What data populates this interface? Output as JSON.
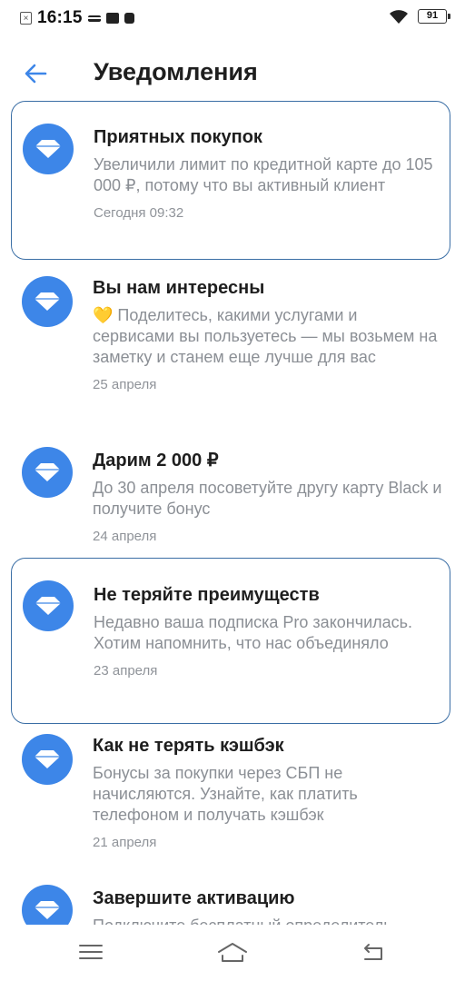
{
  "status_bar": {
    "time": "16:15",
    "battery": "91",
    "icons": [
      "close-notif-icon",
      "menu-icon",
      "message-icon",
      "mic-icon",
      "wifi-icon",
      "battery-icon"
    ]
  },
  "header": {
    "back_icon": "back-arrow-icon",
    "title": "Уведомления"
  },
  "colors": {
    "accent": "#3d86e8",
    "highlight_border": "#3a6ea5",
    "secondary_text": "#8b8f95"
  },
  "notifications": [
    {
      "title": "Приятных покупок",
      "body": "Увеличили лимит по кредитной карте до 105 000 ₽, потому что вы активный клиент",
      "date": "Сегодня 09:32",
      "highlighted": true,
      "icon": "diamond-icon"
    },
    {
      "title": "Вы нам интересны",
      "body": "💛 Поделитесь, какими услугами и сервисами вы пользуетесь — мы возьмем на заметку и станем еще лучше для вас",
      "date": "25 апреля",
      "highlighted": false,
      "icon": "diamond-icon"
    },
    {
      "title": "Дарим 2 000 ₽",
      "body": "До 30 апреля посоветуйте другу карту Black и получите бонус",
      "date": "24 апреля",
      "highlighted": false,
      "icon": "diamond-icon"
    },
    {
      "title": "Не теряйте преимуществ",
      "body": "Недавно ваша подписка Pro закончилась. Хотим напомнить, что нас объединяло",
      "date": "23 апреля",
      "highlighted": true,
      "icon": "diamond-icon"
    },
    {
      "title": "Как не терять кэшбэк",
      "body": "Бонусы за покупки через СБП не начисляются. Узнайте, как платить телефоном и получать кэшбэк",
      "date": "21 апреля",
      "highlighted": false,
      "icon": "diamond-icon"
    },
    {
      "title": "Завершите активацию",
      "body": "Подключите бесплатный определитель",
      "date": "",
      "highlighted": false,
      "icon": "diamond-icon"
    }
  ],
  "nav_bar": {
    "icons": [
      "menu-icon",
      "home-icon",
      "back-icon"
    ]
  }
}
